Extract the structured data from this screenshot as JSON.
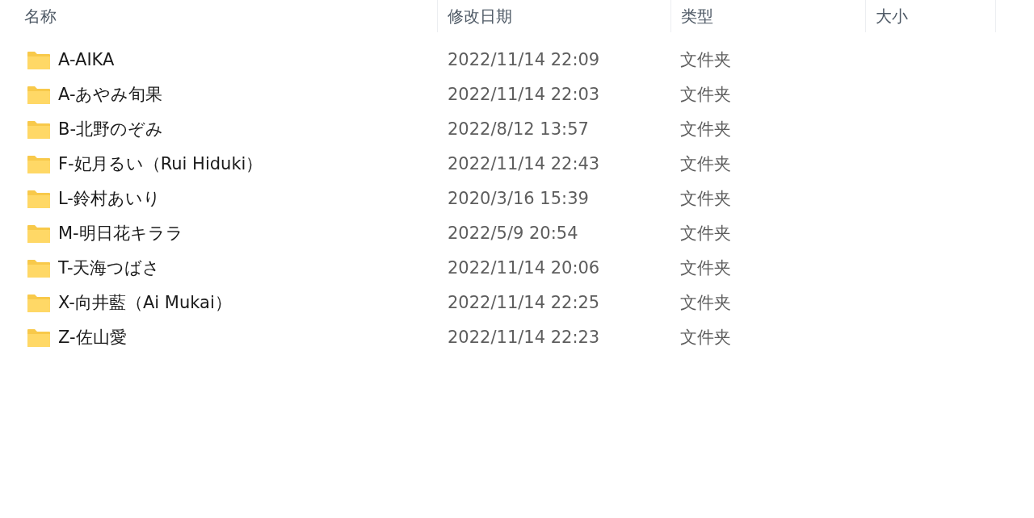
{
  "columns": [
    "名称",
    "修改日期",
    "类型",
    "大小"
  ],
  "rows": [
    {
      "name": "A-AIKA",
      "modified": "2022/11/14 22:09",
      "type": "文件夹"
    },
    {
      "name": "A-あやみ旬果",
      "modified": "2022/11/14 22:03",
      "type": "文件夹"
    },
    {
      "name": "B-北野のぞみ",
      "modified": "2022/8/12 13:57",
      "type": "文件夹"
    },
    {
      "name": "F-妃月るい（Rui Hiduki）",
      "modified": "2022/11/14 22:43",
      "type": "文件夹"
    },
    {
      "name": "L-鈴村あいり",
      "modified": "2020/3/16 15:39",
      "type": "文件夹"
    },
    {
      "name": "M-明日花キララ",
      "modified": "2022/5/9 20:54",
      "type": "文件夹"
    },
    {
      "name": "T-天海つばさ",
      "modified": "2022/11/14 20:06",
      "type": "文件夹"
    },
    {
      "name": "X-向井藍（Ai Mukai）",
      "modified": "2022/11/14 22:25",
      "type": "文件夹"
    },
    {
      "name": "Z-佐山愛",
      "modified": "2022/11/14 22:23",
      "type": "文件夹"
    }
  ]
}
